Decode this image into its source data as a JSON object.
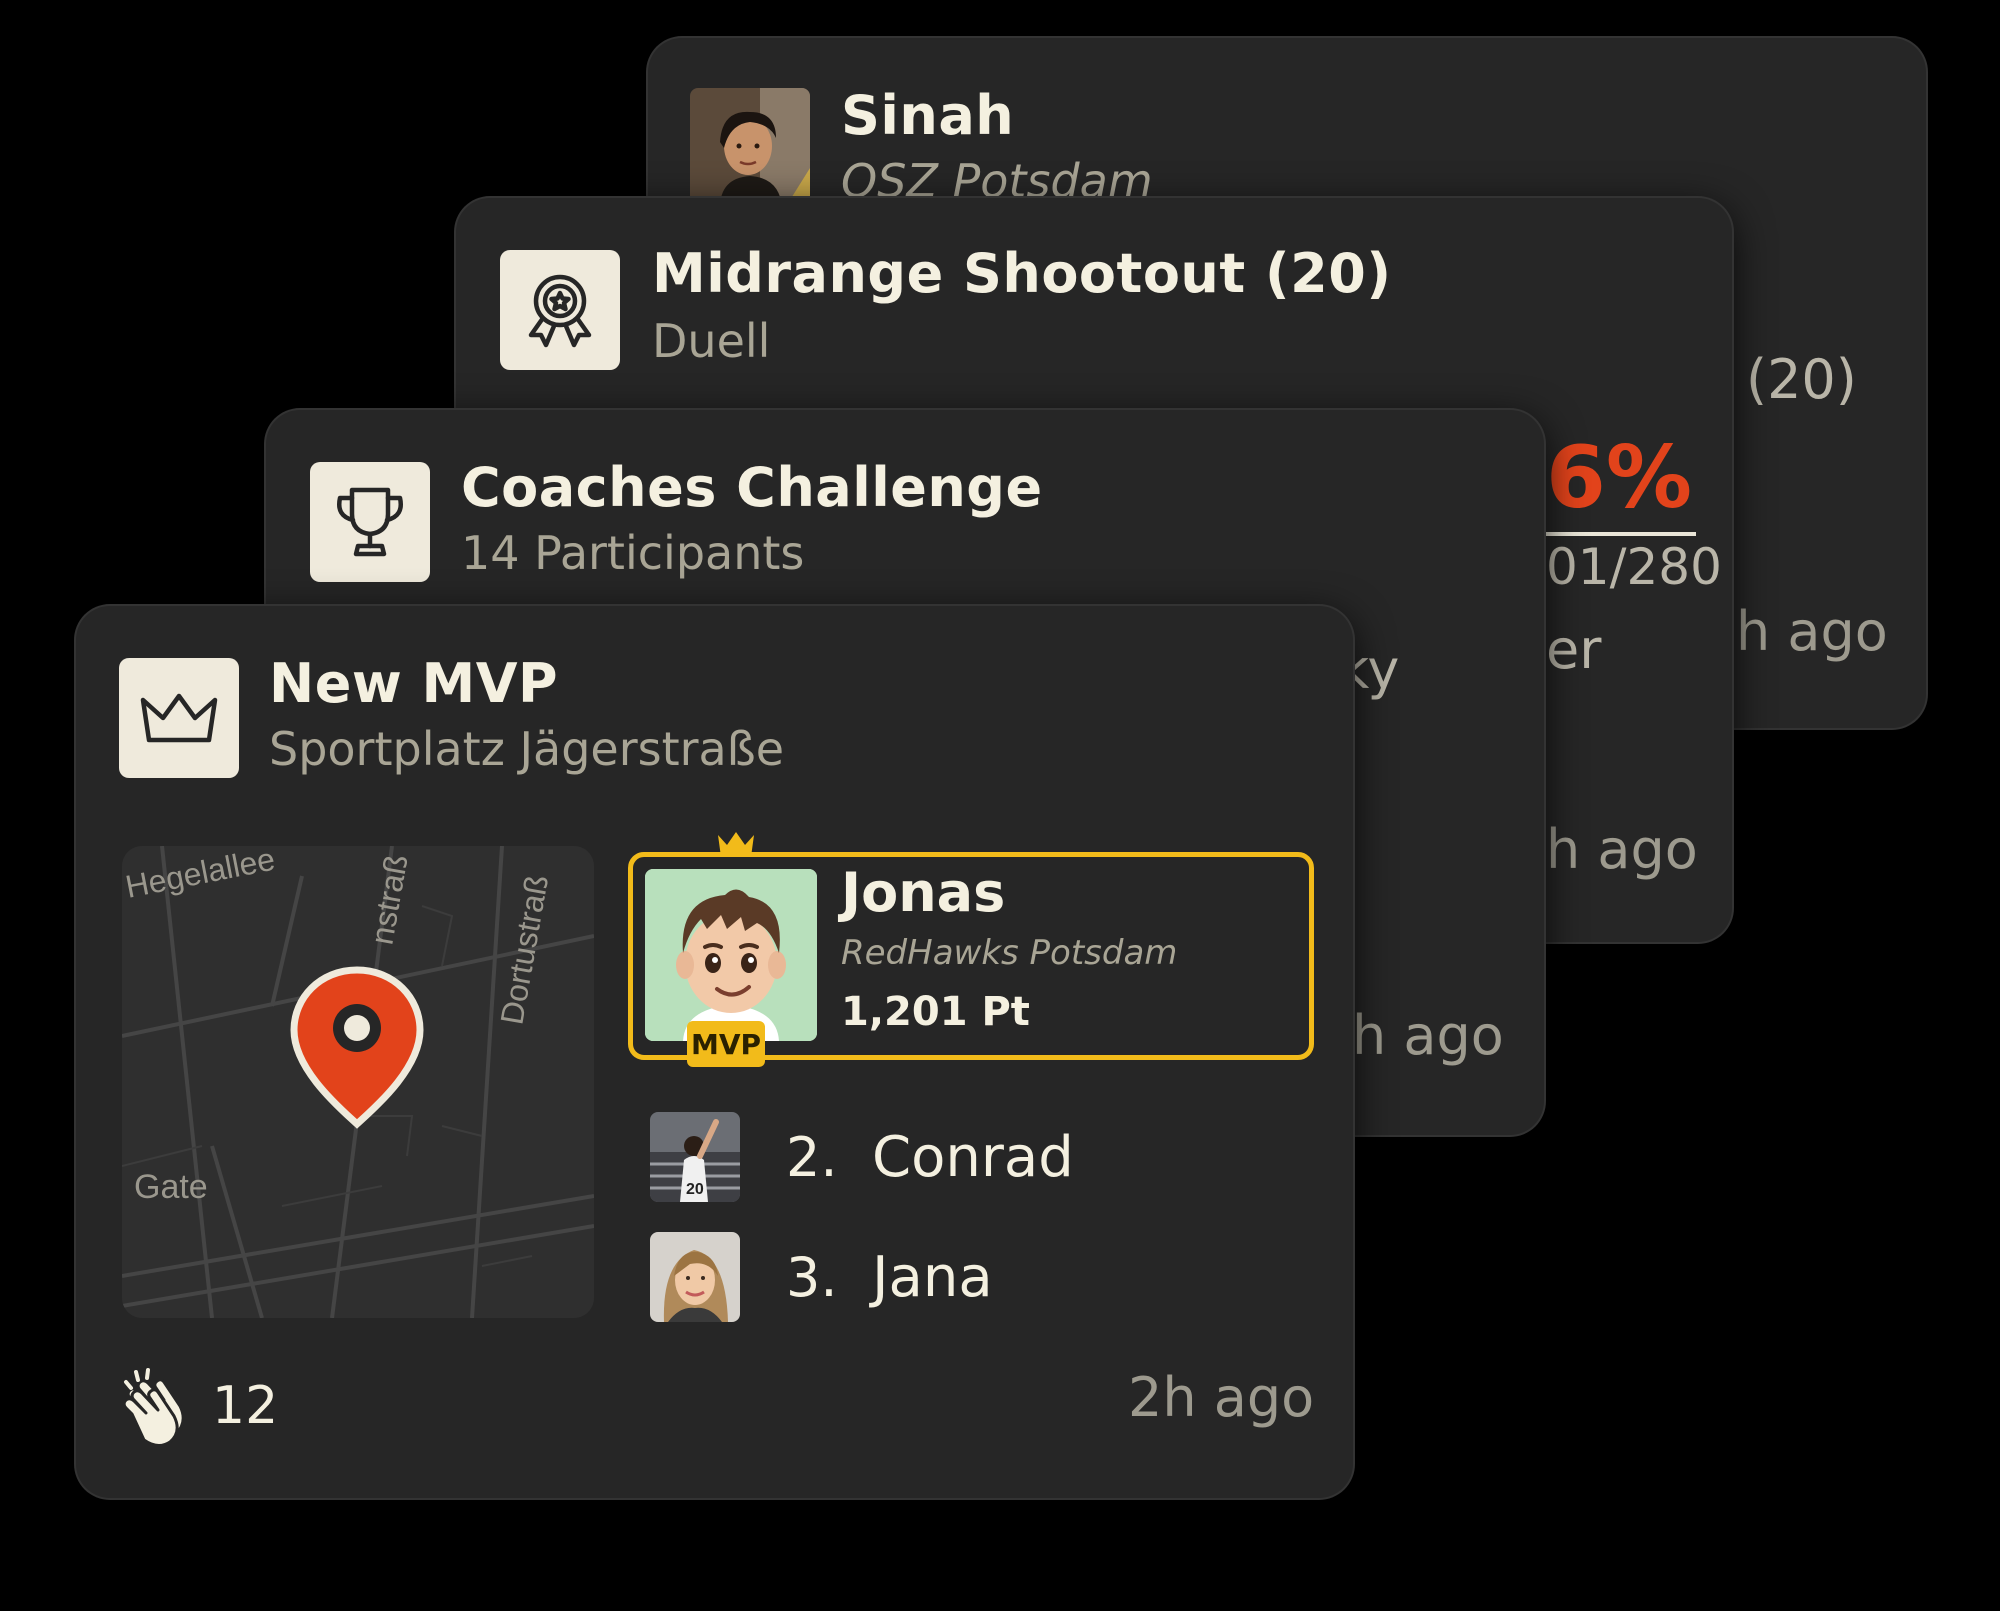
{
  "cards": {
    "sinah": {
      "name": "Sinah",
      "team": "OSZ Potsdam",
      "partial_count": "(20)",
      "time_fragment": "h ago"
    },
    "shootout": {
      "title": "Midrange Shootout (20)",
      "subtitle": "Duell",
      "percent_fragment": "6%",
      "ratio_fragment": "01/280",
      "text_fragment": "er",
      "time_fragment": "h ago"
    },
    "challenge": {
      "title": "Coaches Challenge",
      "subtitle": "14 Participants",
      "text_fragment": "ky",
      "time_fragment": "h ago"
    },
    "mvp": {
      "title": "New MVP",
      "subtitle": "Sportplatz Jägerstraße",
      "map_labels": {
        "street1": "Hegelallee",
        "street2": "nstraß",
        "street3": "Dortustraß",
        "street4": "Gate"
      },
      "winner": {
        "name": "Jonas",
        "team": "RedHawks Potsdam",
        "points": "1,201 Pt",
        "badge": "MVP"
      },
      "ranking": [
        {
          "rank": "2.",
          "name": "Conrad"
        },
        {
          "rank": "3.",
          "name": "Jana"
        }
      ],
      "claps": "12",
      "time": "2h ago"
    }
  },
  "colors": {
    "background": "#000000",
    "card": "#262626",
    "accent_orange": "#e2431b",
    "mvp_gold": "#f2bb1a",
    "icon_bg": "#efeadc"
  },
  "icons": {
    "sinah": "player-photo",
    "shootout": "award-ribbon-icon",
    "challenge": "trophy-icon",
    "mvp": "crown-icon",
    "map_pin": "location-pin-icon",
    "claps": "clapping-hands-icon"
  }
}
